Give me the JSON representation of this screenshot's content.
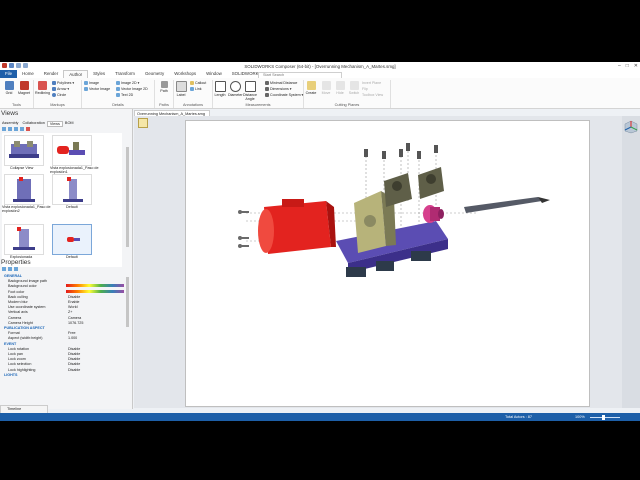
{
  "window": {
    "title": "SOLIDWORKS Composer (64-bit) - [Overrunning Mechanism_A_Martes.smg]",
    "controls": [
      "–",
      "□",
      "✕"
    ]
  },
  "menu": {
    "tabs": [
      "File",
      "Home",
      "Render",
      "Author",
      "Styles",
      "Transform",
      "Geometry",
      "Workshops",
      "Window",
      "SOLIDWORKS PDM"
    ],
    "search_placeholder": "Start Search"
  },
  "ribbon": {
    "tools": {
      "buttons": [
        "Grid",
        "Magnet"
      ],
      "label": "Tools"
    },
    "markups": {
      "big": "Redlining",
      "small": [
        "Polylines ▾",
        "Arrow ▾",
        "Circle"
      ],
      "label": "Markups"
    },
    "details": {
      "small": [
        "Image",
        "Vector Image",
        "Image 2D ▾",
        "Vector Image 2D",
        "Text 2D"
      ],
      "label": "Details"
    },
    "paths": {
      "big": [
        "Path",
        "Label"
      ],
      "label": "Paths"
    },
    "annotations": {
      "small": [
        "Callout",
        "Link"
      ],
      "label": "Annotations"
    },
    "measurements": {
      "big": [
        "Length",
        "Diameter",
        "Distance Angle"
      ],
      "small": [
        "Minimal Distance",
        "Dimensions ▾",
        "Coordinate System ▾"
      ],
      "label": "Measurements"
    },
    "cutting": {
      "big": [
        "Create",
        "Move",
        "Hide",
        "Switch"
      ],
      "small": [
        "Invert Plane",
        "Flip",
        "Toolbox View"
      ],
      "label": "Cutting Planes"
    }
  },
  "views_panel": {
    "title": "Views",
    "tabs": [
      "Assembly",
      "Collaboration",
      "Views",
      "BOM"
    ],
    "thumbnails": [
      {
        "label": "Collapse View"
      },
      {
        "label": "Vista explosionada1_Paso de explosión1"
      },
      {
        "label": "Vista explosionada1_Paso de explosión2"
      },
      {
        "label": "Default"
      },
      {
        "label": "Explosionada"
      },
      {
        "label": "Default"
      }
    ]
  },
  "properties_panel": {
    "title": "Properties",
    "rows": [
      {
        "k": "GENERAL",
        "v": "",
        "section": true
      },
      {
        "k": "Background image path",
        "v": ""
      },
      {
        "k": "Background color",
        "v": ""
      },
      {
        "k": "Foot color",
        "v": ""
      },
      {
        "k": "Back culling",
        "v": "Disable"
      },
      {
        "k": "Modern blur",
        "v": "Enable"
      },
      {
        "k": "Use coordinate system",
        "v": "World"
      },
      {
        "k": "Vertical axis",
        "v": "Z+"
      },
      {
        "k": "Camera",
        "v": "Camera"
      },
      {
        "k": "Camera Height",
        "v": "1076.725"
      },
      {
        "k": "PUBLICATION ASPECT",
        "v": "",
        "section": true
      },
      {
        "k": "Format",
        "v": "Free"
      },
      {
        "k": "Aspect (width:height)",
        "v": "1.000"
      },
      {
        "k": "EVENT",
        "v": "",
        "section": true
      },
      {
        "k": "Lock rotation",
        "v": "Disable"
      },
      {
        "k": "Lock pan",
        "v": "Disable"
      },
      {
        "k": "Lock zoom",
        "v": "Disable"
      },
      {
        "k": "Lock selection",
        "v": "Disable"
      },
      {
        "k": "Lock highlighting",
        "v": "Disable"
      },
      {
        "k": "LIGHTS",
        "v": "",
        "section": true
      }
    ]
  },
  "document": {
    "tab": "Overrunning Mechanism_A_Martes.smg"
  },
  "timeline": {
    "label": "Timeline"
  },
  "status": {
    "actors": "Total Actors : 87",
    "zoom": "100%"
  },
  "colors": {
    "accent": "#1d5fa8",
    "motor": "#e3231f",
    "base": "#5b4db3",
    "bracket": "#7b7a55",
    "coupling": "#d63f8d"
  }
}
